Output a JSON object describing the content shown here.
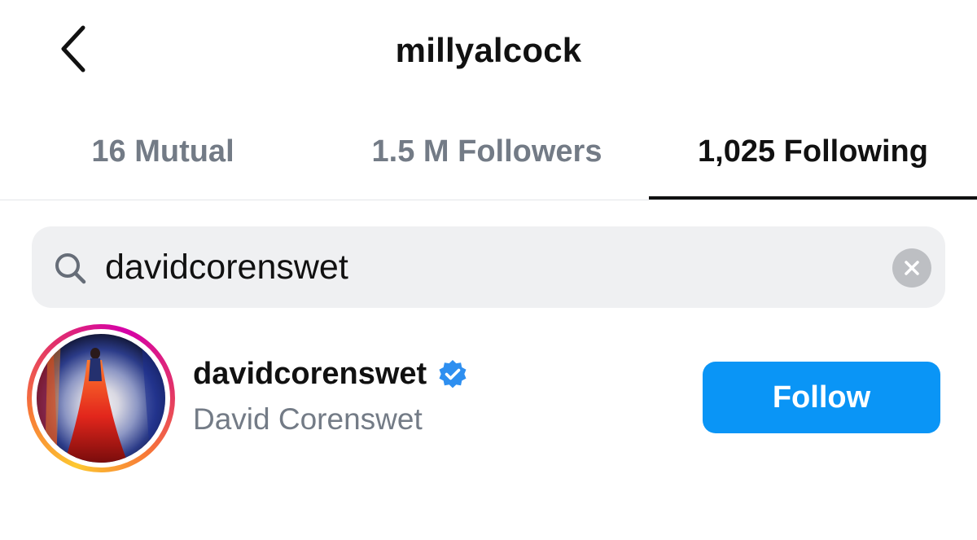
{
  "header": {
    "title": "millyalcock",
    "back_icon": "chevron-left-icon"
  },
  "tabs": [
    {
      "label": "16 Mutual",
      "active": false
    },
    {
      "label": "1.5 M Followers",
      "active": false
    },
    {
      "label": "1,025 Following",
      "active": true
    }
  ],
  "search": {
    "value": "davidcorenswet",
    "search_icon": "search-icon",
    "clear_icon": "clear-icon"
  },
  "results": [
    {
      "username": "davidcorenswet",
      "full_name": "David Corenswet",
      "verified": true,
      "follow_label": "Follow"
    }
  ],
  "colors": {
    "primary_text": "#111111",
    "secondary_text": "#737b86",
    "follow_button": "#0a95f6",
    "search_bg": "#eff0f2",
    "verified_badge": "#2e8ff0"
  }
}
